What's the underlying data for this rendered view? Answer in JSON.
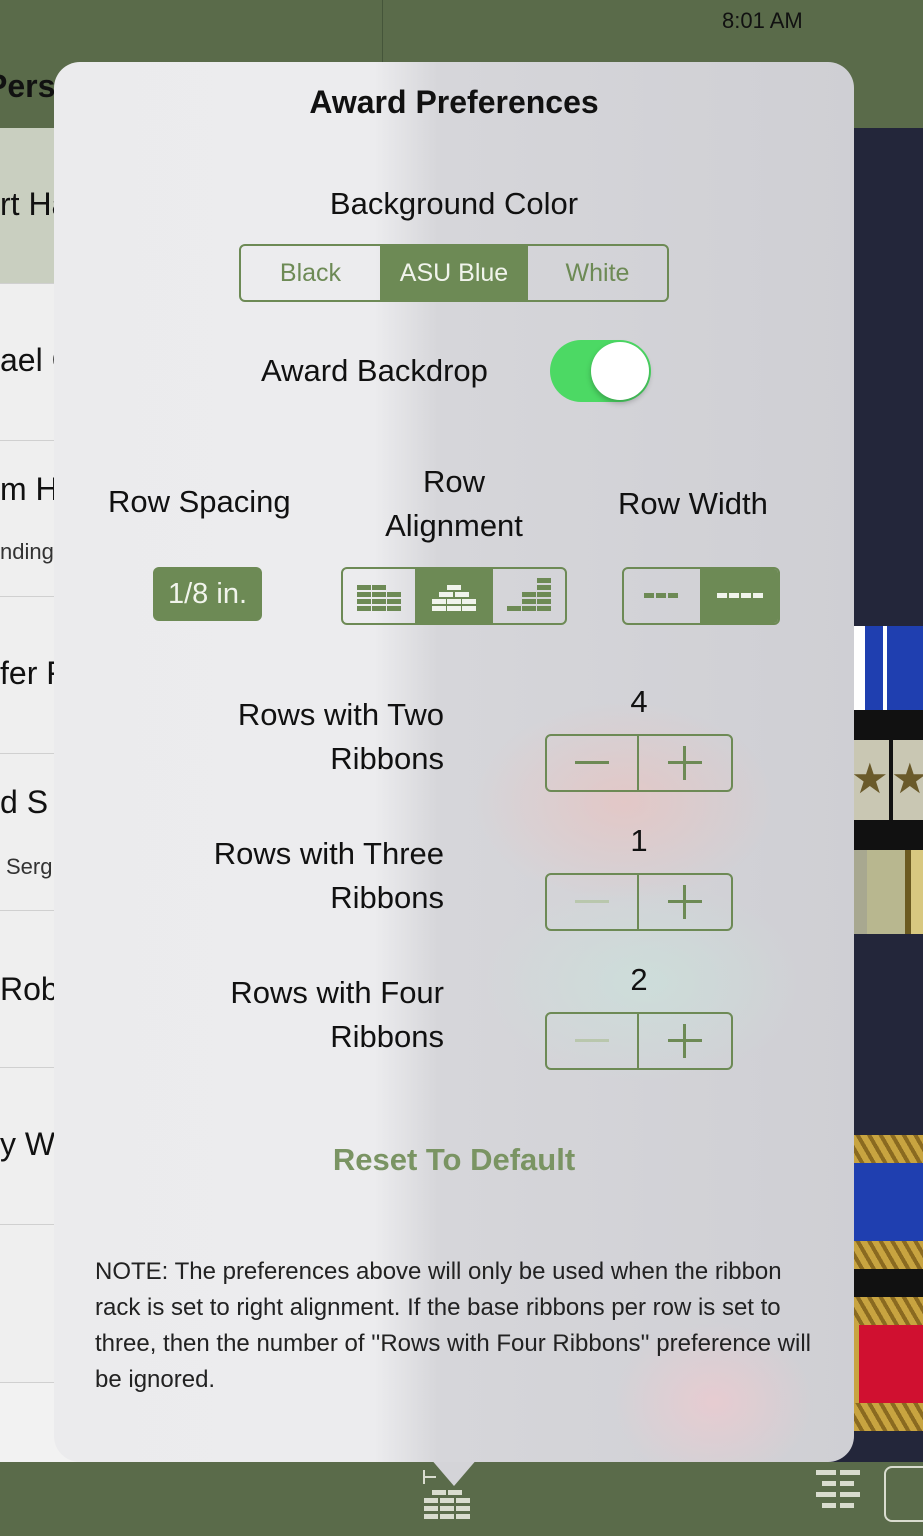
{
  "status_bar": {
    "time": "8:01 AM"
  },
  "master": {
    "title_fragment": "Pers",
    "rows": [
      {
        "name": "rt Ha",
        "sub": "",
        "selected": true
      },
      {
        "name": "ael C",
        "sub": ""
      },
      {
        "name": "m H",
        "sub": "nding"
      },
      {
        "name": "fer F",
        "sub": ""
      },
      {
        "name": "d S",
        "sub": "Serg"
      },
      {
        "name": "Robe",
        "sub": ""
      },
      {
        "name": "y W",
        "sub": ""
      },
      {
        "name": "",
        "sub": ""
      }
    ]
  },
  "popover": {
    "title": "Award Preferences",
    "background_color": {
      "label": "Background Color",
      "options": [
        "Black",
        "ASU Blue",
        "White"
      ],
      "selected": "ASU Blue"
    },
    "award_backdrop": {
      "label": "Award Backdrop",
      "on": true
    },
    "row_spacing": {
      "label": "Row Spacing",
      "value": "1/8 in."
    },
    "row_alignment": {
      "label_line1": "Row",
      "label_line2": "Alignment",
      "selected_index": 1
    },
    "row_width": {
      "label": "Row Width",
      "selected_index": 1
    },
    "rows_two": {
      "label_line1": "Rows with Two",
      "label_line2": "Ribbons",
      "count": "4"
    },
    "rows_three": {
      "label_line1": "Rows with Three",
      "label_line2": "Ribbons",
      "count": "1"
    },
    "rows_four": {
      "label_line1": "Rows with Four",
      "label_line2": "Ribbons",
      "count": "2"
    },
    "reset_label": "Reset To Default",
    "note": "NOTE: The preferences above will only be used when the ribbon rack is set to right alignment.  If the base ribbons per row is set to three, then the number of ''Rows with Four Ribbons'' preference will be ignored."
  },
  "colors": {
    "accent": "#6d8a55",
    "toggle_on": "#4cd964",
    "chrome": "#5a6b4a"
  },
  "icons": [
    "minus-icon",
    "plus-icon",
    "align-left-icon",
    "align-center-icon",
    "align-right-icon",
    "width-narrow-icon",
    "width-wide-icon",
    "ribbon-rack-icon",
    "list-layout-icon"
  ]
}
